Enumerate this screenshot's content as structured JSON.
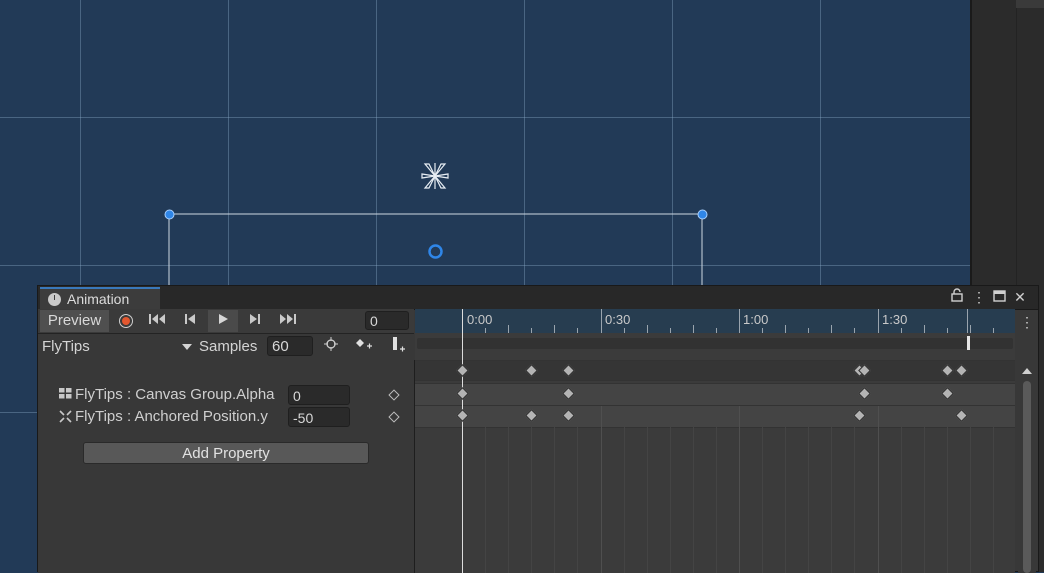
{
  "window": {
    "tab_label": "Animation",
    "lock_icon": "lock-icon",
    "menu_icon": "kebab-menu-icon",
    "maximize_icon": "maximize-icon",
    "close_icon": "close-icon"
  },
  "toolbar": {
    "preview_label": "Preview",
    "frame_value": "0",
    "buttons": [
      "record-icon",
      "first-key-icon",
      "prev-key-icon",
      "play-icon",
      "next-key-icon",
      "last-key-icon"
    ]
  },
  "clip": {
    "name": "FlyTips",
    "samples_label": "Samples",
    "samples_value": "60",
    "icons": [
      "snap-icon",
      "add-keyframe-icon",
      "add-event-icon"
    ]
  },
  "properties": [
    {
      "label": "FlyTips : Canvas Group.Alpha",
      "value": "0",
      "icon": "canvas-group-icon"
    },
    {
      "label": "FlyTips : Anchored Position.y",
      "value": "-50",
      "icon": "rect-transform-icon"
    }
  ],
  "add_property_label": "Add Property",
  "timeline": {
    "labels": [
      "0:00",
      "0:30",
      "1:00",
      "1:30"
    ],
    "keyframes": {
      "summary": [
        0,
        15,
        23,
        86,
        87,
        105,
        108
      ],
      "alpha": [
        0,
        23,
        87,
        105
      ],
      "position_y": [
        0,
        15,
        23,
        86,
        108
      ]
    }
  },
  "scene": {
    "gizmo_icon": "particle-gizmo-icon",
    "pivot_icon": "pivot-icon"
  },
  "colors": {
    "scene_bg": "#223a57",
    "record": "#e2572f",
    "tab_accent": "#3a79bb"
  }
}
